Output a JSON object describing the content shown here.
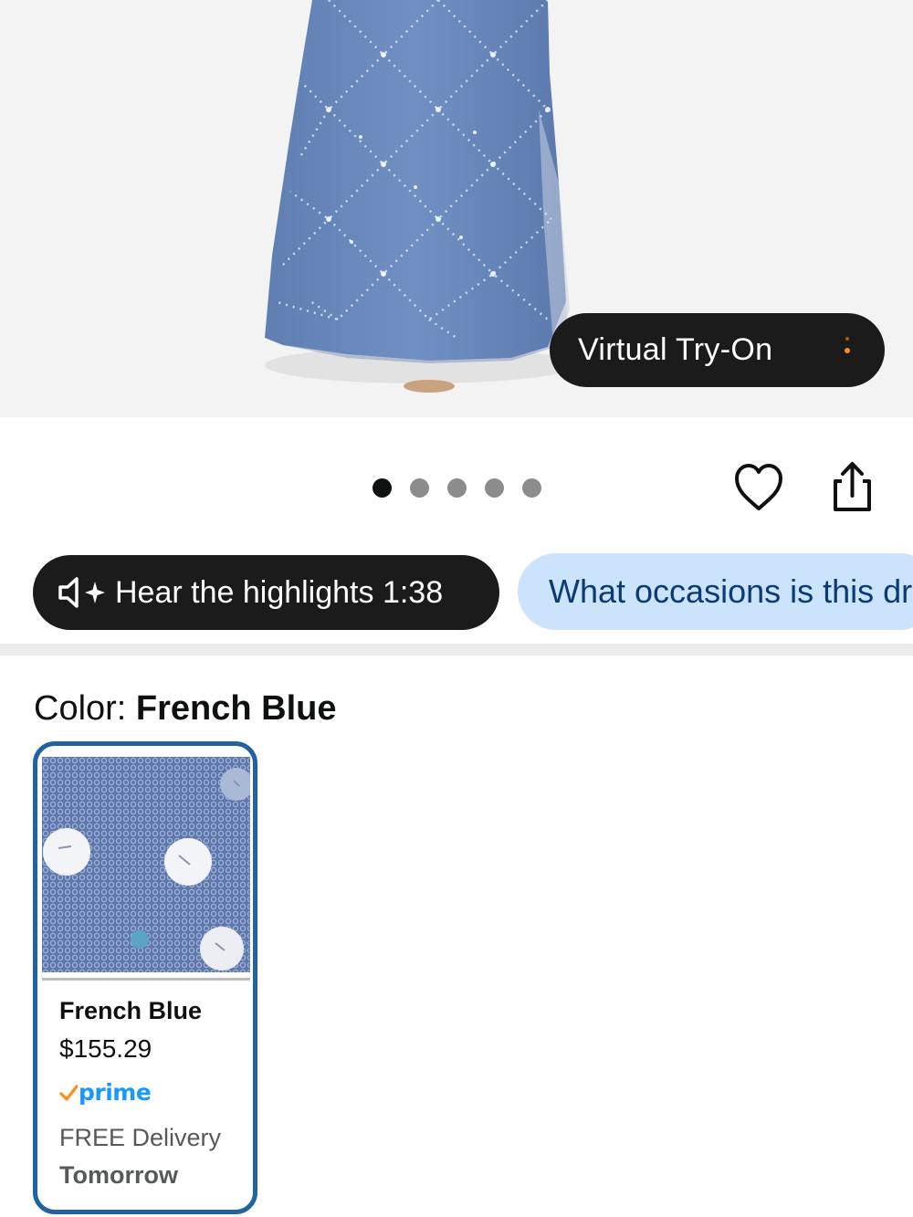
{
  "hero": {
    "image": "blue-beaded-gown-product-photo",
    "tryon_label": "Virtual Try-On"
  },
  "carousel": {
    "dot_count": 5,
    "active_index": 0
  },
  "actions": {
    "favorite_icon": "heart-icon",
    "share_icon": "share-icon"
  },
  "chips": {
    "hear_label": "Hear the highlights 1:38",
    "ask_label": "What occasions is this dress suitable for?"
  },
  "color": {
    "label": "Color: ",
    "selected": "French Blue"
  },
  "swatches": [
    {
      "name": "French Blue",
      "price": "$155.29",
      "prime": "prime",
      "delivery_line1": "FREE Delivery",
      "delivery_line2": "Tomorrow",
      "selected": true
    }
  ],
  "colors": {
    "dark_pill": "#1b1b1b",
    "chip_bg": "#cce4fb",
    "chip_text": "#0b3a78",
    "selected_border": "#2162a1",
    "prime_blue": "#1a98ff",
    "prime_check": "#ff8c1a"
  }
}
